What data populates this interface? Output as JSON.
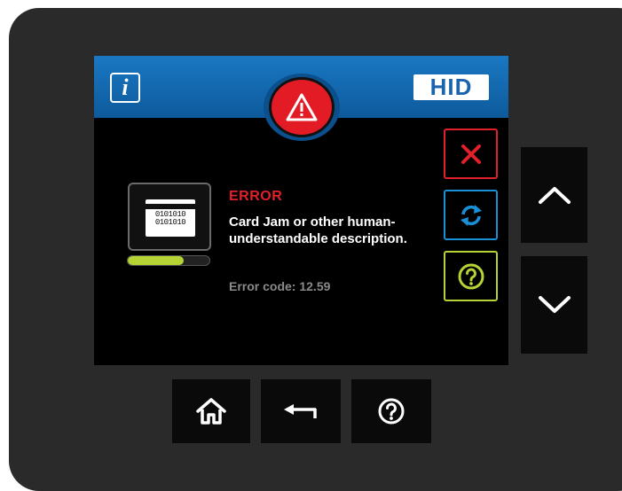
{
  "screen": {
    "header": {
      "info_label": "i",
      "logo_text": "HID",
      "alert_icon": "warning-triangle-icon"
    },
    "status": {
      "illustration": "printer-card-icon",
      "card_binary": [
        "0101010",
        "0101010"
      ],
      "progress_fraction": 0.68,
      "title": "ERROR",
      "description": "Card Jam or other human-understandable description.",
      "error_code": "Error code: 12.59"
    },
    "actions": [
      {
        "icon": "close-icon",
        "color": "#e0202a"
      },
      {
        "icon": "retry-icon",
        "color": "#1a8fd6"
      },
      {
        "icon": "help-icon",
        "color": "#b5d334"
      }
    ]
  },
  "hardware_buttons": [
    {
      "icon": "chevron-up-icon"
    },
    {
      "icon": "chevron-down-icon"
    },
    {
      "icon": "home-icon"
    },
    {
      "icon": "back-arrow-icon"
    },
    {
      "icon": "help-icon"
    }
  ],
  "colors": {
    "accent_red": "#e0202a",
    "accent_blue": "#1a8fd6",
    "accent_green": "#b5d334",
    "header_blue": "#1a78c2"
  }
}
